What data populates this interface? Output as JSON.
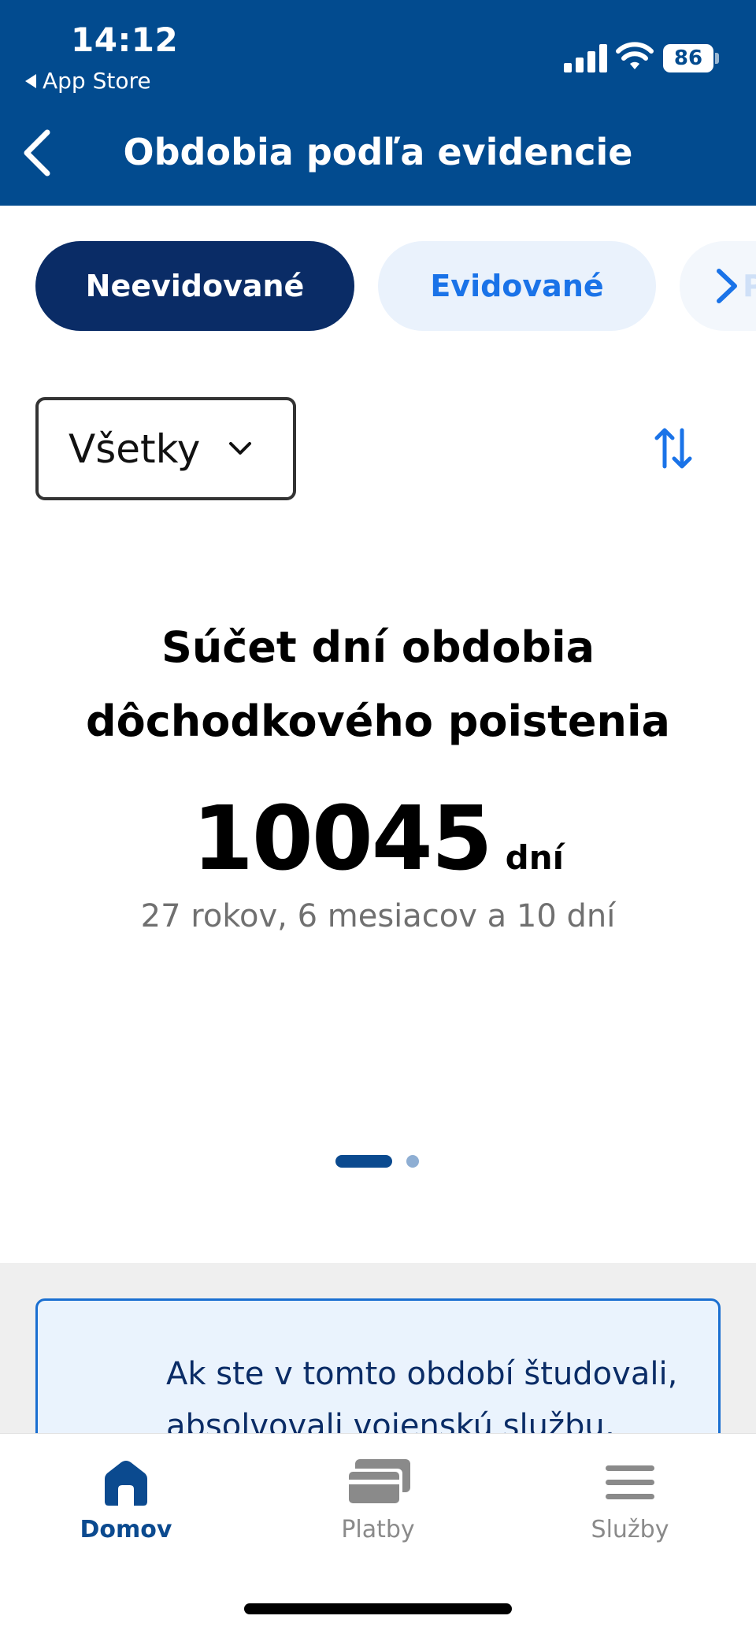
{
  "status_bar": {
    "time": "14:12",
    "back_app": "App Store",
    "battery": "86"
  },
  "header": {
    "title": "Obdobia podľa evidencie"
  },
  "tabs": [
    {
      "label": "Neevidované",
      "active": true
    },
    {
      "label": "Evidované",
      "active": false
    },
    {
      "label": "Po",
      "active": false
    }
  ],
  "filter": {
    "selected": "Všetky"
  },
  "summary": {
    "title_line1": "Súčet dní obdobia",
    "title_line2": "dôchodkového poistenia",
    "days_value": "10045",
    "days_unit": "dní",
    "duration": "27 rokov, 6 mesiacov a 10 dní"
  },
  "pager": {
    "current": 1,
    "total": 2
  },
  "info": {
    "text": "Ak ste v tomto období študovali, absolvovali vojenskú službu,"
  },
  "bottom_nav": {
    "home": "Domov",
    "payments": "Platby",
    "services": "Služby"
  },
  "colors": {
    "header_bg": "#024b8f",
    "tab_active_bg": "#0a2c66",
    "accent": "#1a73e8",
    "info_border": "#1a6fd1"
  },
  "icons": {
    "back": "chevron-left-icon",
    "dropdown": "chevron-down-icon",
    "sort": "sort-arrows-icon",
    "home": "home-icon",
    "payments": "cards-icon",
    "services": "menu-icon"
  }
}
